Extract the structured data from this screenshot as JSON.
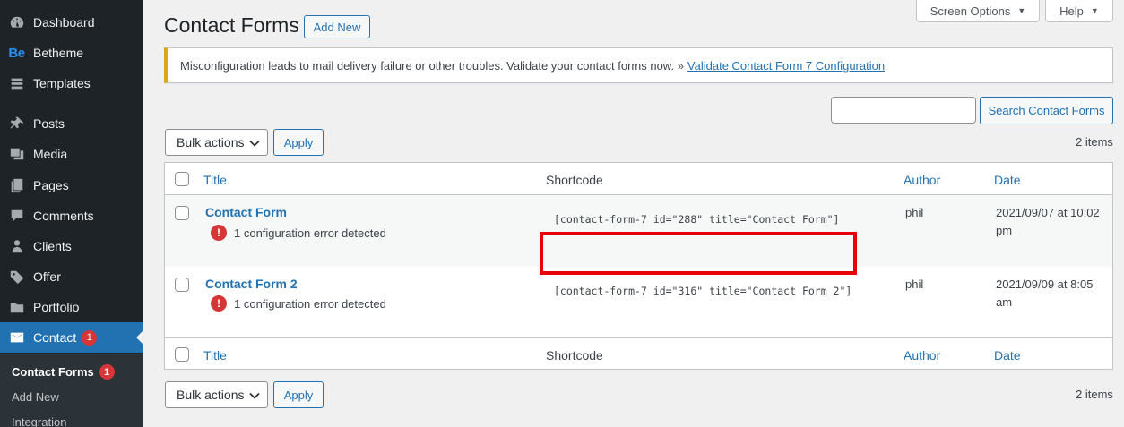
{
  "sidebar": {
    "items": [
      {
        "label": "Dashboard",
        "icon": "dashboard-icon"
      },
      {
        "label": "Betheme",
        "icon": "betheme-logo-icon",
        "logo": "Be"
      },
      {
        "label": "Templates",
        "icon": "templates-icon"
      },
      {
        "label": "Posts",
        "icon": "pin-icon"
      },
      {
        "label": "Media",
        "icon": "media-icon"
      },
      {
        "label": "Pages",
        "icon": "pages-icon"
      },
      {
        "label": "Comments",
        "icon": "comments-icon"
      },
      {
        "label": "Clients",
        "icon": "clients-icon"
      },
      {
        "label": "Offer",
        "icon": "tag-icon"
      },
      {
        "label": "Portfolio",
        "icon": "portfolio-icon"
      },
      {
        "label": "Contact",
        "icon": "mail-icon",
        "badge": "1",
        "active": true
      }
    ],
    "submenu": [
      {
        "label": "Contact Forms",
        "badge": "1",
        "current": true
      },
      {
        "label": "Add New"
      },
      {
        "label": "Integration"
      }
    ]
  },
  "top": {
    "screen_options": "Screen Options",
    "help": "Help"
  },
  "header": {
    "title": "Contact Forms",
    "add_new": "Add New"
  },
  "notice": {
    "text": "Misconfiguration leads to mail delivery failure or other troubles. Validate your contact forms now. »",
    "link": "Validate Contact Form 7 Configuration"
  },
  "search": {
    "value": "",
    "button": "Search Contact Forms"
  },
  "bulk": {
    "select": "Bulk actions",
    "apply": "Apply",
    "count": "2 items"
  },
  "table": {
    "columns": {
      "title": "Title",
      "shortcode": "Shortcode",
      "author": "Author",
      "date": "Date"
    },
    "rows": [
      {
        "title": "Contact Form",
        "error": "1 configuration error detected",
        "shortcode": "[contact-form-7 id=\"288\" title=\"Contact Form\"]",
        "author": "phil",
        "date": "2021/09/07 at 10:02 pm"
      },
      {
        "title": "Contact Form 2",
        "error": "1 configuration error detected",
        "shortcode": "[contact-form-7 id=\"316\" title=\"Contact Form 2\"]",
        "author": "phil",
        "date": "2021/09/09 at 8:05 am"
      }
    ]
  },
  "colors": {
    "sidebar_bg": "#1d2327",
    "active": "#2271b1",
    "badge": "#d63638",
    "notice_border": "#dba617",
    "highlight": "#e8000b"
  }
}
